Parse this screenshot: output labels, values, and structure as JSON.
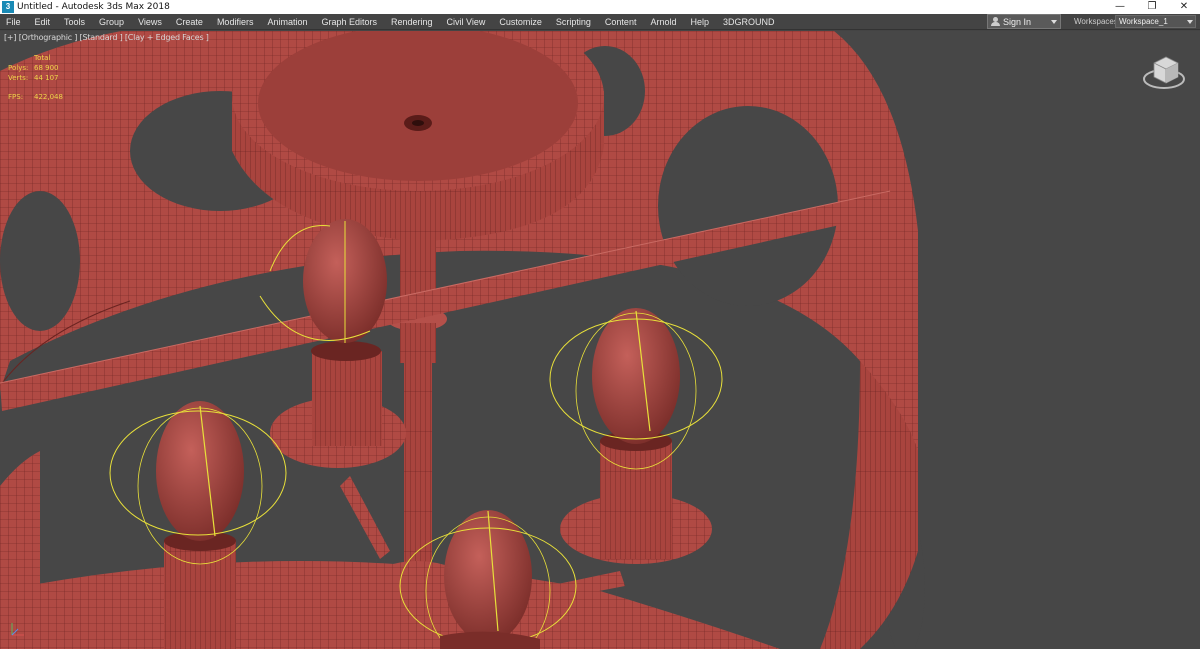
{
  "window": {
    "title": "Untitled - Autodesk 3ds Max 2018",
    "minimize": "—",
    "restore": "❐",
    "close": "✕"
  },
  "menu": [
    "File",
    "Edit",
    "Tools",
    "Group",
    "Views",
    "Create",
    "Modifiers",
    "Animation",
    "Graph Editors",
    "Rendering",
    "Civil View",
    "Customize",
    "Scripting",
    "Content",
    "Arnold",
    "Help",
    "3DGROUND"
  ],
  "account": {
    "signin_label": "Sign In"
  },
  "workspaces": {
    "label": "Workspaces:",
    "value": "Workspace_1"
  },
  "viewport": {
    "label": "[+] [Orthographic ] [Standard ] [Clay + Edged Faces ]",
    "stats": {
      "header": "Total",
      "polys_label": "Polys:",
      "polys_value": "68 900",
      "verts_label": "Verts:",
      "verts_value": "44 107",
      "fps_label": "FPS:",
      "fps_value": "422,048"
    }
  },
  "colors": {
    "mesh": "#b5504a",
    "mesh_dark": "#8a3732",
    "wire": "#5a1c19",
    "light_gizmo": "#e8e03a",
    "background": "#474747"
  }
}
